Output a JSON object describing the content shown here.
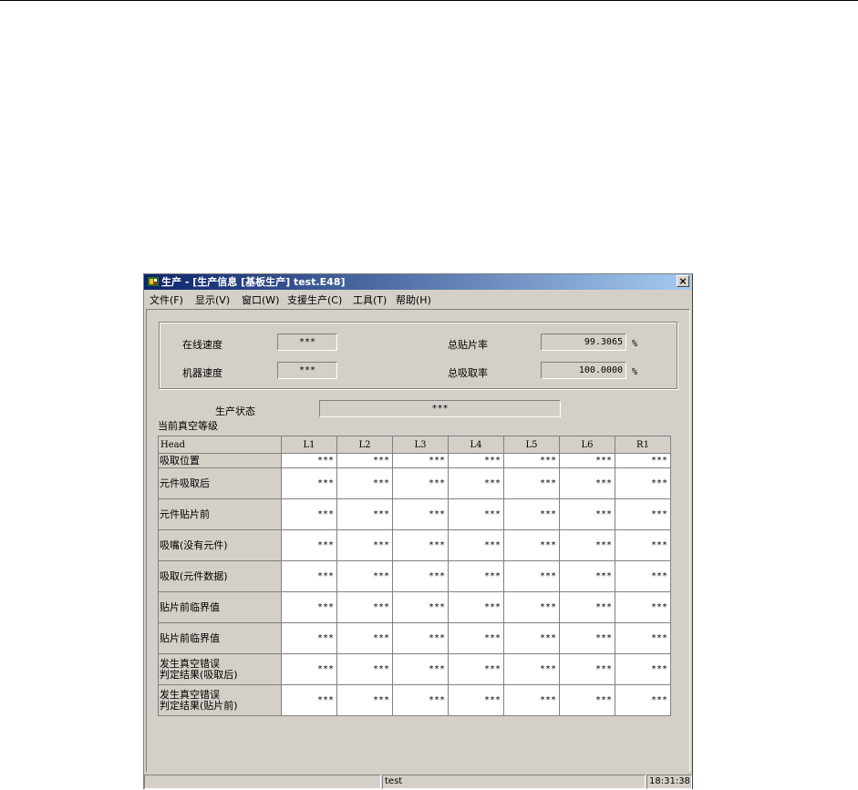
{
  "window": {
    "title": "生产 - [生产信息 [基板生产] test.E48]",
    "close_label": "×"
  },
  "menu": [
    "文件(F)",
    "显示(V)",
    "窗口(W)",
    "支援生产(C)",
    "工具(T)",
    "帮助(H)"
  ],
  "stats": {
    "online_speed": {
      "label": "在线速度",
      "value": "***"
    },
    "machine_speed": {
      "label": "机器速度",
      "value": "***"
    },
    "total_placement_rate": {
      "label": "总贴片率",
      "value": "99.3065",
      "unit": "%"
    },
    "total_pickup_rate": {
      "label": "总吸取率",
      "value": "100.0000",
      "unit": "%"
    }
  },
  "production_status": {
    "label": "生产状态",
    "value": "***"
  },
  "vacuum_level_label": "当前真空等级",
  "table": {
    "corner": "Head",
    "columns": [
      "L1",
      "L2",
      "L3",
      "L4",
      "L5",
      "L6",
      "R1"
    ],
    "rows": [
      {
        "label": [
          "吸取位置"
        ],
        "values": [
          "***",
          "***",
          "***",
          "***",
          "***",
          "***",
          "***"
        ]
      },
      {
        "label": [
          "元件吸取后"
        ],
        "values": [
          "***",
          "***",
          "***",
          "***",
          "***",
          "***",
          "***"
        ]
      },
      {
        "label": [
          "元件贴片前"
        ],
        "values": [
          "***",
          "***",
          "***",
          "***",
          "***",
          "***",
          "***"
        ]
      },
      {
        "label": [
          "吸嘴(没有元件)"
        ],
        "values": [
          "***",
          "***",
          "***",
          "***",
          "***",
          "***",
          "***"
        ]
      },
      {
        "label": [
          "吸取(元件数据)"
        ],
        "values": [
          "***",
          "***",
          "***",
          "***",
          "***",
          "***",
          "***"
        ]
      },
      {
        "label": [
          "贴片前临界值"
        ],
        "values": [
          "***",
          "***",
          "***",
          "***",
          "***",
          "***",
          "***"
        ]
      },
      {
        "label": [
          "贴片前临界值"
        ],
        "values": [
          "***",
          "***",
          "***",
          "***",
          "***",
          "***",
          "***"
        ]
      },
      {
        "label": [
          "发生真空错误",
          "判定结果(吸取后)"
        ],
        "values": [
          "***",
          "***",
          "***",
          "***",
          "***",
          "***",
          "***"
        ]
      },
      {
        "label": [
          "发生真空错误",
          "判定结果(贴片前)"
        ],
        "values": [
          "***",
          "***",
          "***",
          "***",
          "***",
          "***",
          "***"
        ]
      }
    ]
  },
  "statusbar": {
    "file": "test",
    "time": "18:31:38"
  }
}
